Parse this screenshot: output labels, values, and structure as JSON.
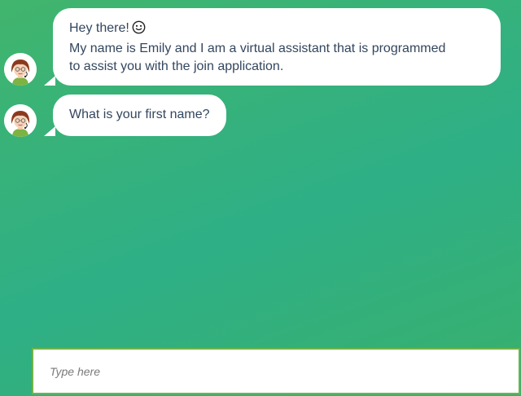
{
  "chat": {
    "messages": [
      {
        "sender_icon": "assistant-avatar-icon",
        "lines": [
          "Hey there!",
          "My name is Emily and I am a virtual assistant that is programmed",
          "to assist you with the join application."
        ],
        "emoji": "smiley-icon"
      },
      {
        "sender_icon": "assistant-avatar-icon",
        "lines": [
          "What is your first name?"
        ]
      }
    ]
  },
  "input": {
    "placeholder": "Type here",
    "value": ""
  },
  "colors": {
    "background_start": "#41b56d",
    "background_mid": "#2eaf86",
    "bubble": "#ffffff",
    "text": "#33465e",
    "input_border": "#6fb44a"
  }
}
